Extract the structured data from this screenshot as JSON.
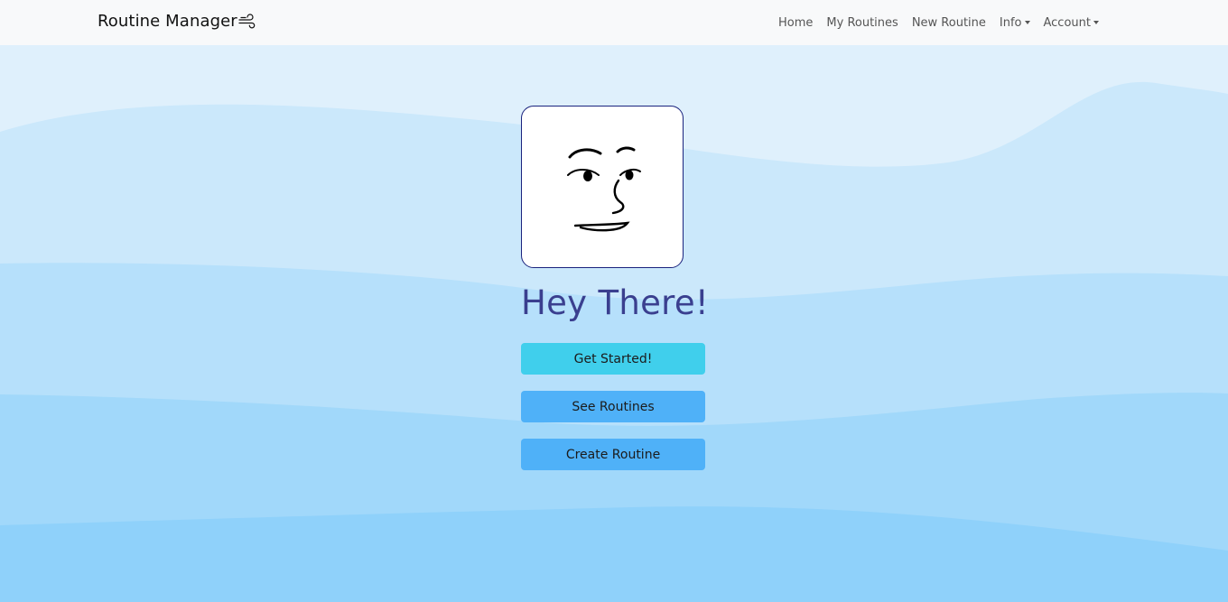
{
  "navbar": {
    "brand": "Routine Manager",
    "brand_icon": "wind-icon",
    "links": {
      "home": "Home",
      "my_routines": "My Routines",
      "new_routine": "New Routine",
      "info": "Info",
      "account": "Account"
    }
  },
  "hero": {
    "avatar_icon": "face-icon",
    "title": "Hey There!",
    "buttons": {
      "get_started": "Get Started!",
      "see_routines": "See Routines",
      "create_routine": "Create Routine"
    }
  },
  "colors": {
    "navbar_bg": "#f8f9fa",
    "title": "#3a3f8f",
    "primary_button": "#40cfec",
    "secondary_button": "#4fb1f8",
    "wave_light": "#dff0fc",
    "wave_dark": "#8fd1fa"
  }
}
